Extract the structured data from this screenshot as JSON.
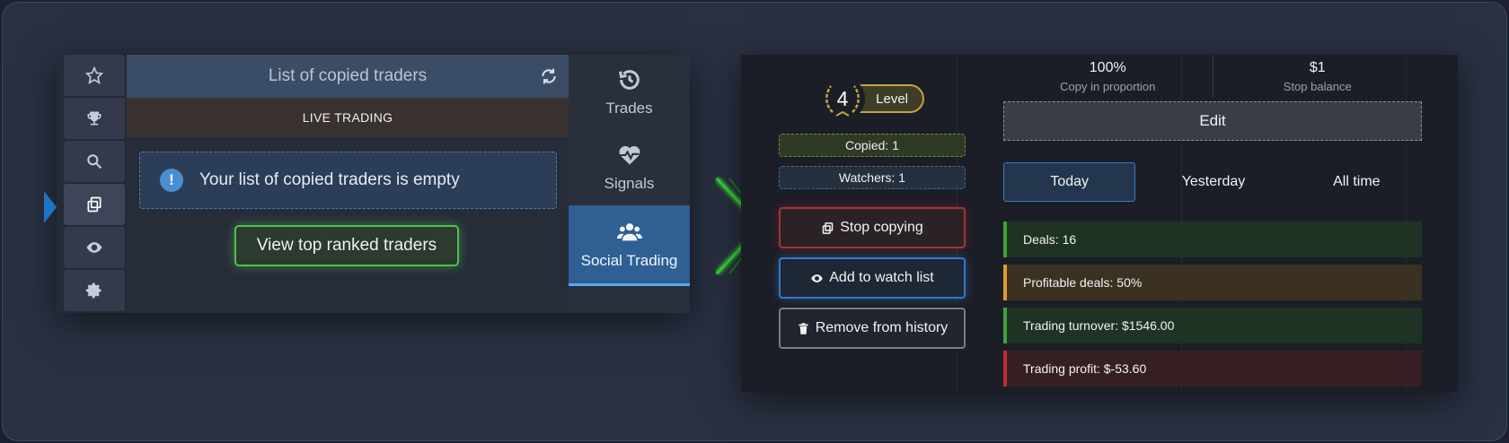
{
  "left": {
    "nav_icons": [
      "star-icon",
      "trophy-icon",
      "search-icon",
      "copy-icon",
      "eye-icon",
      "gear-icon"
    ],
    "header_title": "List of copied traders",
    "mode_label": "LIVE TRADING",
    "empty_message": "Your list of copied traders is empty",
    "top_ranked_button": "View top ranked traders",
    "side_menu": [
      {
        "label": "Trades",
        "icon": "history-icon"
      },
      {
        "label": "Signals",
        "icon": "heartbeat-icon"
      },
      {
        "label": "Social Trading",
        "icon": "users-icon"
      }
    ]
  },
  "right": {
    "level_number": "4",
    "level_label": "Level",
    "copied_label": "Copied: 1",
    "watchers_label": "Watchers: 1",
    "stop_copying": "Stop copying",
    "add_watch": "Add to watch list",
    "remove_history": "Remove from history",
    "proportion_value": "100%",
    "proportion_label": "Copy in proportion",
    "stop_balance_value": "$1",
    "stop_balance_label": "Stop balance",
    "edit_label": "Edit",
    "period_tabs": [
      "Today",
      "Yesterday",
      "All time"
    ],
    "metrics": [
      {
        "text": "Deals: 16",
        "color": "#3fa23c"
      },
      {
        "text": "Profitable deals: 50%",
        "color": "#e19a2a"
      },
      {
        "text": "Trading turnover: $1546.00",
        "color": "#3fa23c"
      },
      {
        "text": "Trading profit: $-53.60",
        "color": "#c02c2c"
      }
    ]
  },
  "colors": {
    "accent_blue": "#2f79c8",
    "accent_green": "#4cc14d",
    "accent_red": "#a33535",
    "gold": "#c2a441"
  }
}
